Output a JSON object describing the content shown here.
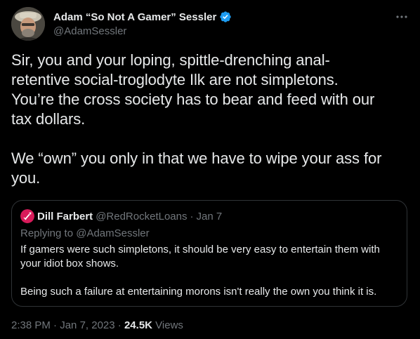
{
  "author": {
    "display_name": "Adam “So Not A Gamer” Sessler",
    "handle": "@AdamSessler",
    "verified": true,
    "avatar_icon": "avatar-photo-icon"
  },
  "tweet": {
    "text": "Sir, you and your loping, spittle-drenching anal-\nretentive social-troglodyte Ilk are not simpletons.\nYou’re the cross society has to bear and feed with our\ntax dollars.\n\nWe “own” you only in that we have to wipe your ass for\nyou."
  },
  "quote": {
    "display_name": "Dill Farbert",
    "handle": "@RedRocketLoans",
    "separator": "·",
    "date": "Jan 7",
    "replying_to": "Replying to @AdamSessler",
    "text": "If gamers were such simpletons, it should be very easy to entertain them with\nyour idiot box shows.\n\nBeing such a failure at entertaining morons isn't really the own you think it is."
  },
  "footer": {
    "time": "2:38 PM",
    "separator": "·",
    "date": "Jan 7, 2023",
    "views_count": "24.5K",
    "views_label": "Views"
  },
  "colors": {
    "background": "#000000",
    "primary_text": "#e7e9ea",
    "secondary_text": "#71767b",
    "border": "#2f3336",
    "verified_badge": "#1d9bf0",
    "quote_avatar": "#d81b5a"
  }
}
